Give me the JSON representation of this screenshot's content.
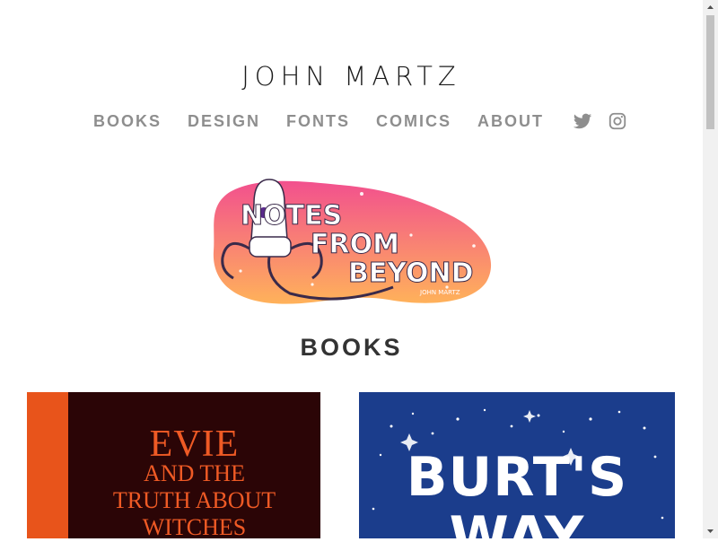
{
  "site": {
    "title": "JOHN MARTZ"
  },
  "nav": {
    "items": [
      "BOOKS",
      "DESIGN",
      "FONTS",
      "COMICS",
      "ABOUT"
    ],
    "social": [
      "twitter-icon",
      "instagram-icon"
    ]
  },
  "hero": {
    "text": [
      "NOTES",
      "FROM",
      "BEYOND"
    ],
    "author": "JOHN MARTZ",
    "colors": {
      "top": "#f2508e",
      "bottom": "#ffb25a"
    }
  },
  "section": {
    "title": "BOOKS"
  },
  "books": [
    {
      "title_top": "EVIE",
      "title_rest": "AND THE\nTRUTH ABOUT\nWITCHES",
      "bg": "#2b0506",
      "accent": "#e8541b"
    },
    {
      "title": "BURT'S\nWAY",
      "bg": "#1b3d8c"
    }
  ]
}
